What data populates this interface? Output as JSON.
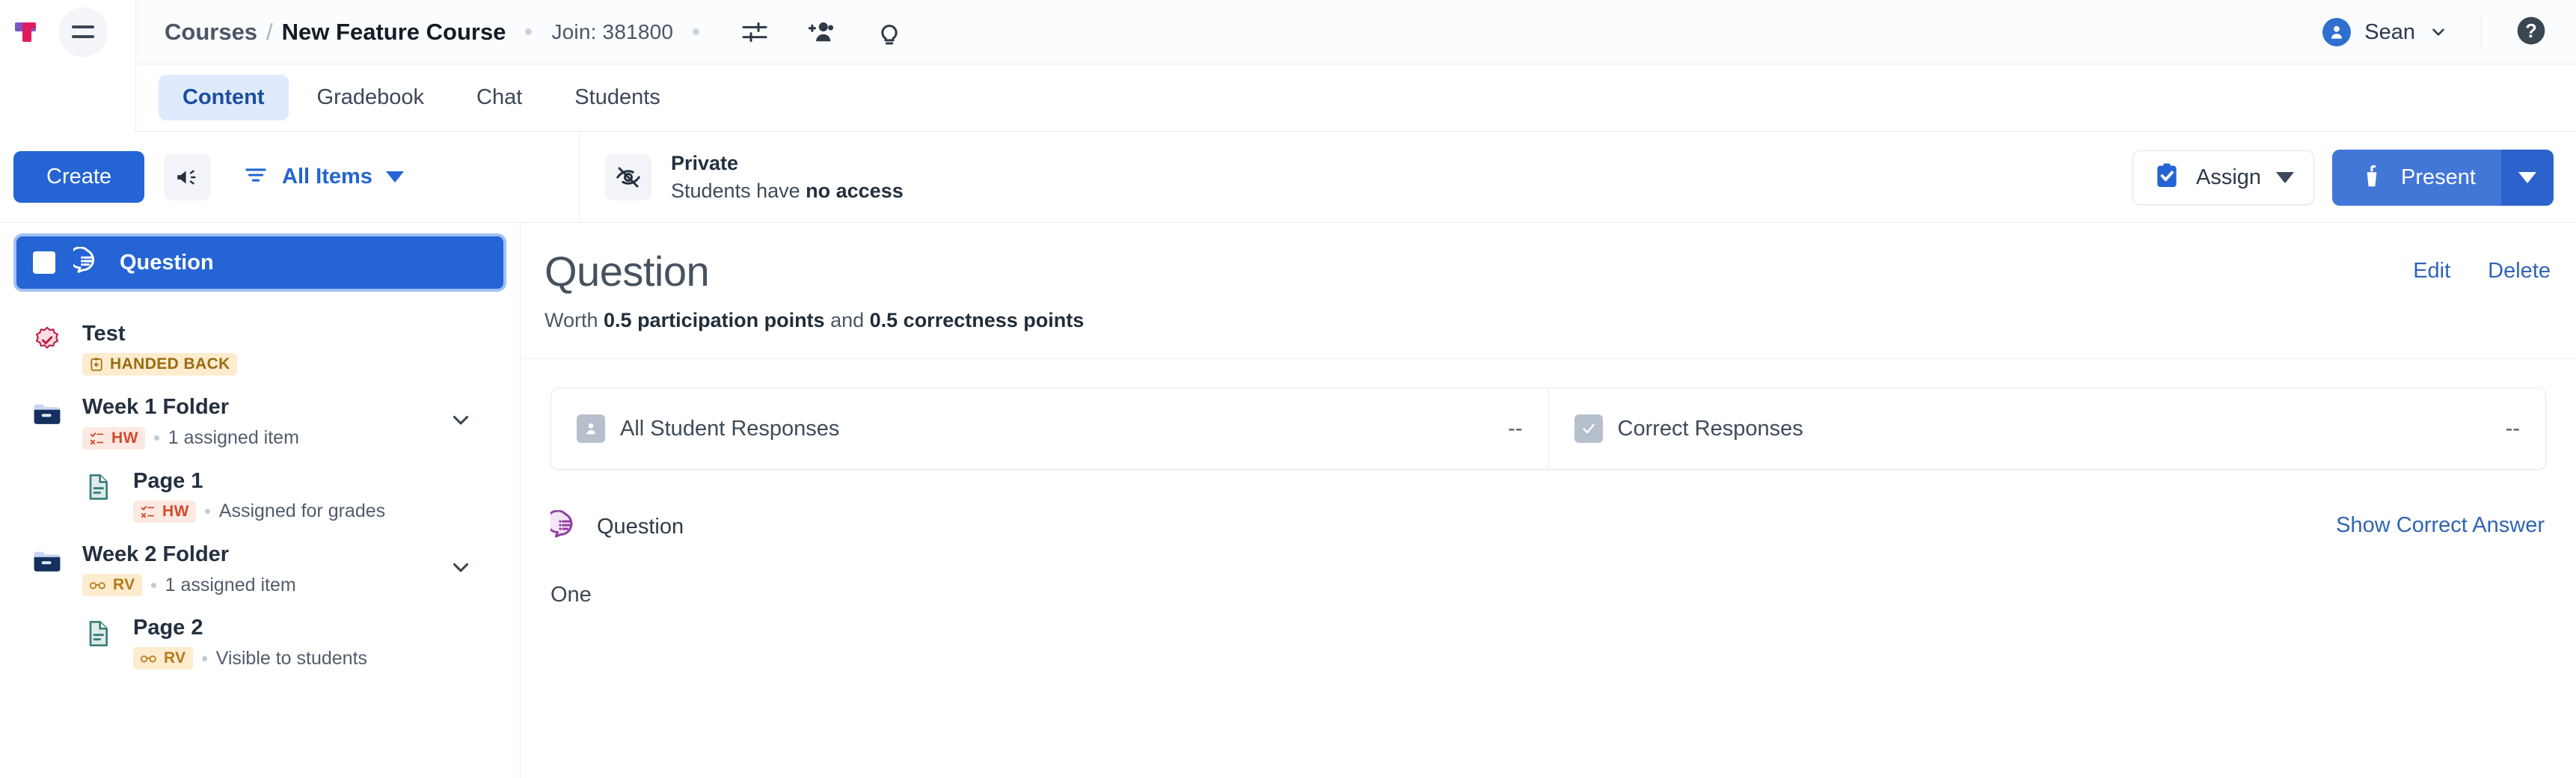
{
  "header": {
    "breadcrumb_root": "Courses",
    "breadcrumb_separator": "/",
    "breadcrumb_current": "New Feature Course",
    "join_code": "Join: 381800",
    "icons": [
      "sliders-icon",
      "add-people-icon",
      "lightbulb-icon"
    ],
    "user_name": "Sean",
    "help_icon": "help-circle-icon",
    "logo": "app-logo",
    "menu_icon": "hamburger-menu-icon",
    "accent_blue": "#2464d4"
  },
  "tabs": [
    {
      "label": "Content",
      "active": true
    },
    {
      "label": "Gradebook",
      "active": false
    },
    {
      "label": "Chat",
      "active": false
    },
    {
      "label": "Students",
      "active": false
    }
  ],
  "toolbar": {
    "create_label": "Create",
    "announce_icon": "megaphone-icon",
    "filter_icon": "filter-icon",
    "filter_label": "All Items",
    "privacy_icon": "eye-off-icon",
    "privacy_title": "Private",
    "privacy_sub_prefix": "Students have ",
    "privacy_sub_strong": "no access",
    "assign_label": "Assign",
    "assign_icon": "clipboard-check-icon",
    "present_label": "Present",
    "present_icon": "podium-icon"
  },
  "sidebar": {
    "selected": {
      "label": "Question",
      "icon": "question-bubble-icon",
      "checkbox": true
    },
    "items": [
      {
        "title": "Test",
        "icon": "badge-check-icon",
        "badge": {
          "text": "HANDED BACK",
          "type": "hb",
          "icon": "handback-icon"
        },
        "meta": "",
        "indent": false,
        "chevron": false
      },
      {
        "title": "Week 1 Folder",
        "icon": "folder-icon",
        "badge": {
          "text": "HW",
          "type": "hw",
          "icon": "checkx-icon"
        },
        "meta": "1 assigned item",
        "indent": false,
        "chevron": true
      },
      {
        "title": "Page 1",
        "icon": "page-icon",
        "badge": {
          "text": "HW",
          "type": "hw",
          "icon": "checkx-icon"
        },
        "meta": "Assigned for grades",
        "indent": true,
        "chevron": false
      },
      {
        "title": "Week 2 Folder",
        "icon": "folder-icon",
        "badge": {
          "text": "RV",
          "type": "rv",
          "icon": "glasses-icon"
        },
        "meta": "1 assigned item",
        "indent": false,
        "chevron": true
      },
      {
        "title": "Page 2",
        "icon": "page-icon",
        "badge": {
          "text": "RV",
          "type": "rv",
          "icon": "glasses-icon"
        },
        "meta": "Visible to students",
        "indent": true,
        "chevron": false
      }
    ]
  },
  "main": {
    "title": "Question",
    "worth_prefix": "Worth ",
    "worth_participation": "0.5 participation points",
    "worth_join": " and ",
    "worth_correctness": "0.5 correctness points",
    "edit_label": "Edit",
    "delete_label": "Delete",
    "stats": [
      {
        "label": "All Student Responses",
        "value": "--",
        "icon": "person-icon"
      },
      {
        "label": "Correct Responses",
        "value": "--",
        "icon": "check-square-icon"
      }
    ],
    "question_section_label": "Question",
    "question_icon": "question-bubble-icon",
    "show_correct_answer": "Show Correct Answer",
    "answer_text": "One"
  }
}
